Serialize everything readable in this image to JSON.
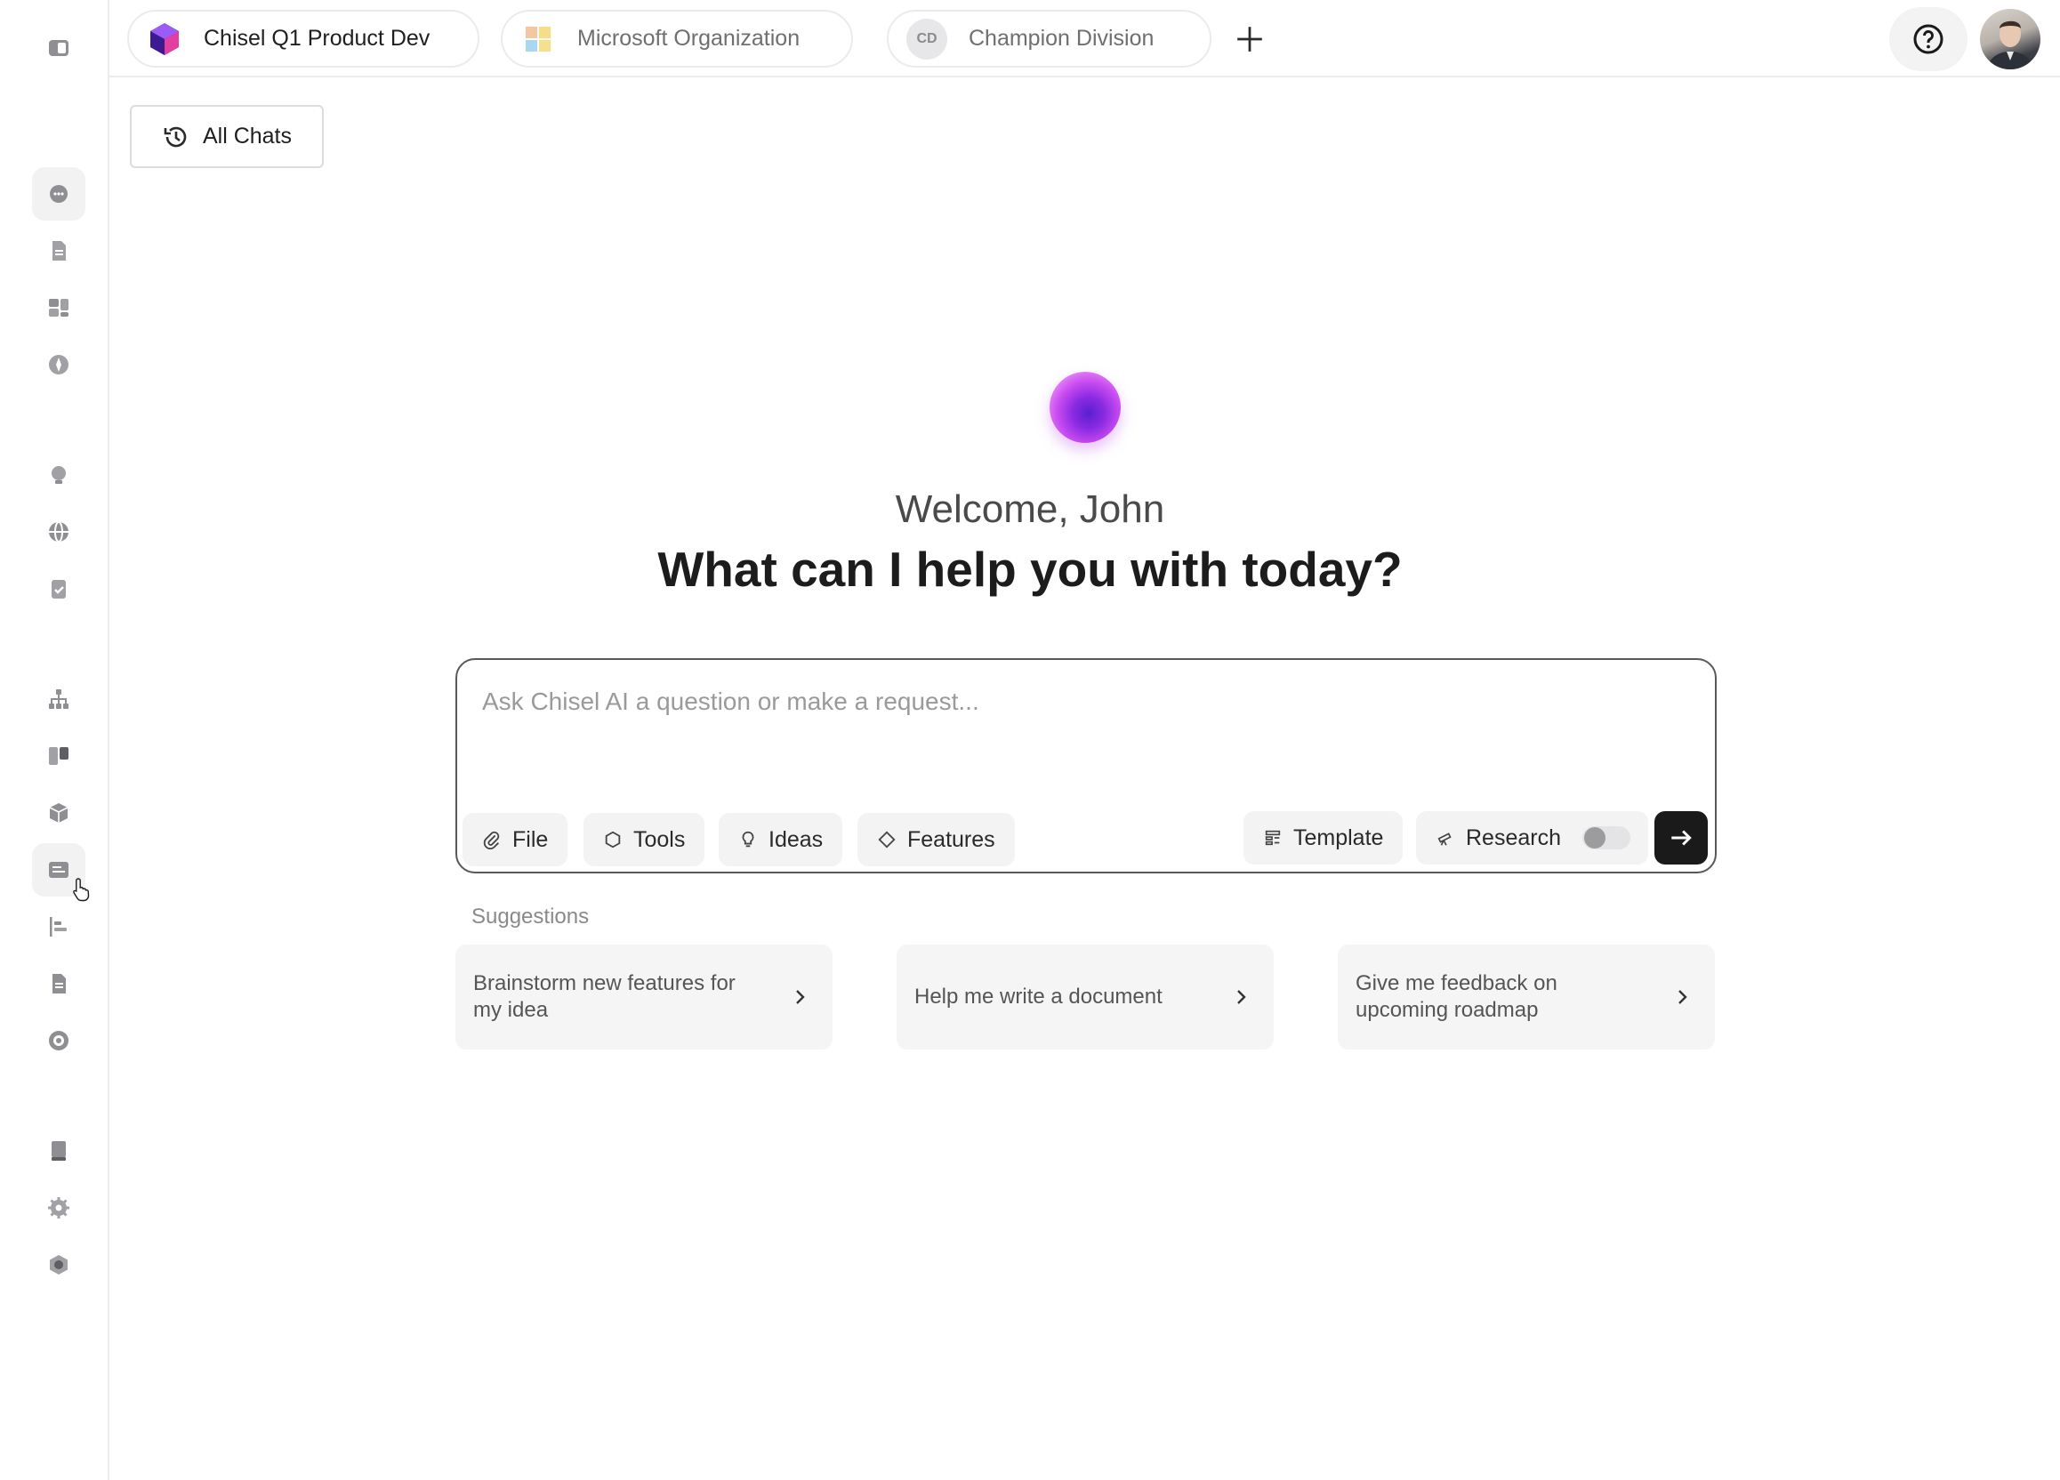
{
  "topbar": {
    "tabs": [
      {
        "label": "Chisel Q1 Product Dev"
      },
      {
        "label": "Microsoft Organization"
      },
      {
        "label": "Champion Division",
        "initials": "CD"
      }
    ]
  },
  "chats": {
    "all_chats_label": "All Chats"
  },
  "hero": {
    "welcome": "Welcome, John",
    "headline": "What can I help you with today?"
  },
  "composer": {
    "placeholder": "Ask Chisel AI a question or make a request...",
    "left_actions": {
      "file": "File",
      "tools": "Tools",
      "ideas": "Ideas",
      "features": "Features"
    },
    "right_actions": {
      "template": "Template",
      "research": "Research"
    },
    "research_enabled": false
  },
  "suggestions": {
    "heading": "Suggestions",
    "items": [
      {
        "text": "Brainstorm new features for my idea"
      },
      {
        "text": "Help me write a document"
      },
      {
        "text": "Give me feedback on upcoming roadmap"
      }
    ]
  },
  "colors": {
    "accent_orb": "#a63ee6",
    "send_button": "#1a1a1a",
    "chip_bg": "#f3f3f4"
  }
}
